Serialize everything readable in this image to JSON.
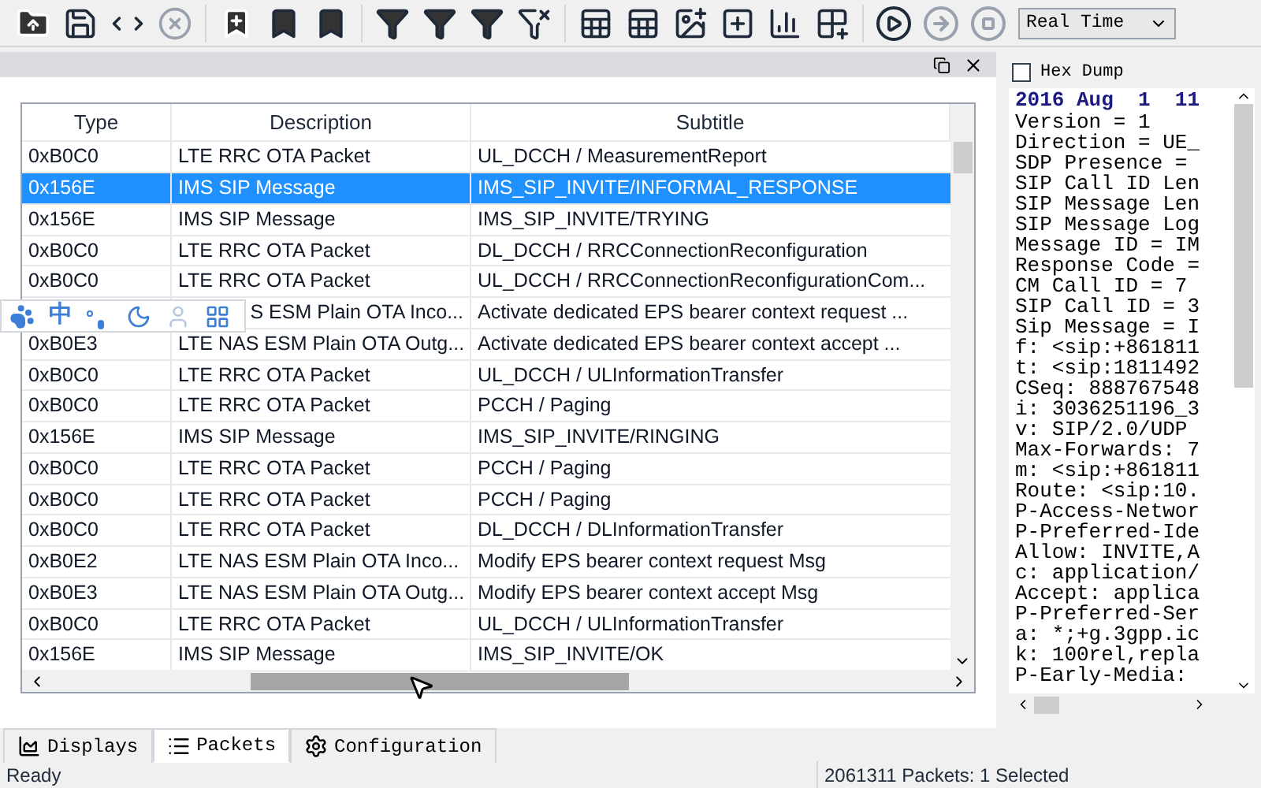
{
  "toolbar": {
    "mode_dropdown": "Real Time"
  },
  "ime_bar": {
    "items": [
      "中"
    ]
  },
  "table": {
    "columns": [
      "Type",
      "Description",
      "Subtitle"
    ],
    "rows": [
      {
        "type": "0xB0C0",
        "description": "LTE RRC OTA Packet",
        "subtitle": "UL_DCCH / MeasurementReport",
        "selected": false
      },
      {
        "type": "0x156E",
        "description": "IMS SIP Message",
        "subtitle": "IMS_SIP_INVITE/INFORMAL_RESPONSE",
        "selected": true
      },
      {
        "type": "0x156E",
        "description": "IMS SIP Message",
        "subtitle": "IMS_SIP_INVITE/TRYING",
        "selected": false
      },
      {
        "type": "0xB0C0",
        "description": "LTE RRC OTA Packet",
        "subtitle": "DL_DCCH / RRCConnectionReconfiguration",
        "selected": false
      },
      {
        "type": "0xB0C0",
        "description": "LTE RRC OTA Packet",
        "subtitle": "UL_DCCH / RRCConnectionReconfigurationCom...",
        "selected": false
      },
      {
        "description": "S ESM Plain OTA Inco...",
        "subtitle": "Activate dedicated EPS bearer context request ...",
        "selected": false
      },
      {
        "type": "0xB0E3",
        "description": "LTE NAS ESM Plain OTA Outg...",
        "subtitle": "Activate dedicated EPS bearer context accept ...",
        "selected": false
      },
      {
        "type": "0xB0C0",
        "description": "LTE RRC OTA Packet",
        "subtitle": "UL_DCCH / ULInformationTransfer",
        "selected": false
      },
      {
        "type": "0xB0C0",
        "description": "LTE RRC OTA Packet",
        "subtitle": "PCCH / Paging",
        "selected": false
      },
      {
        "type": "0x156E",
        "description": "IMS SIP Message",
        "subtitle": "IMS_SIP_INVITE/RINGING",
        "selected": false
      },
      {
        "type": "0xB0C0",
        "description": "LTE RRC OTA Packet",
        "subtitle": "PCCH / Paging",
        "selected": false
      },
      {
        "type": "0xB0C0",
        "description": "LTE RRC OTA Packet",
        "subtitle": "PCCH / Paging",
        "selected": false
      },
      {
        "type": "0xB0C0",
        "description": "LTE RRC OTA Packet",
        "subtitle": "DL_DCCH / DLInformationTransfer",
        "selected": false
      },
      {
        "type": "0xB0E2",
        "description": "LTE NAS ESM Plain OTA Inco...",
        "subtitle": "Modify EPS bearer context request Msg",
        "selected": false
      },
      {
        "type": "0xB0E3",
        "description": "LTE NAS ESM Plain OTA Outg...",
        "subtitle": "Modify EPS bearer context accept Msg",
        "selected": false
      },
      {
        "type": "0xB0C0",
        "description": "LTE RRC OTA Packet",
        "subtitle": "UL_DCCH / ULInformationTransfer",
        "selected": false
      },
      {
        "type": "0x156E",
        "description": "IMS SIP Message",
        "subtitle": "IMS_SIP_INVITE/OK",
        "selected": false
      }
    ]
  },
  "bottom_tabs": [
    {
      "label": "Displays",
      "kind": "displays",
      "selected": false
    },
    {
      "label": "Packets",
      "kind": "packets",
      "selected": true
    },
    {
      "label": "Configuration",
      "kind": "configuration",
      "selected": false
    }
  ],
  "detail": {
    "hex_dump": {
      "label": "Hex Dump",
      "checked": false
    },
    "heading": "2016 Aug  1  11",
    "lines": [
      "Version = 1",
      "Direction = UE_",
      "SDP Presence =",
      "SIP Call ID Len",
      "SIP Message Len",
      "SIP Message Log",
      "Message ID = IM",
      "Response Code =",
      "CM Call ID = 7",
      "SIP Call ID = 3",
      "Sip Message = I",
      "f: <sip:+861811",
      "t: <sip:1811492",
      "CSeq: 888767548",
      "i: 3036251196_3",
      "v: SIP/2.0/UDP",
      "Max-Forwards: 7",
      "m: <sip:+861811",
      "Route: <sip:10.",
      "P-Access-Networ",
      "P-Preferred-Ide",
      "Allow: INVITE,A",
      "c: application/",
      "Accept: applica",
      "P-Preferred-Ser",
      "a: *;+g.3gpp.ic",
      "k: 100rel,repla",
      "P-Early-Media:"
    ]
  },
  "status_bar": {
    "left": "Ready",
    "right": "2061311 Packets: 1 Selected"
  }
}
